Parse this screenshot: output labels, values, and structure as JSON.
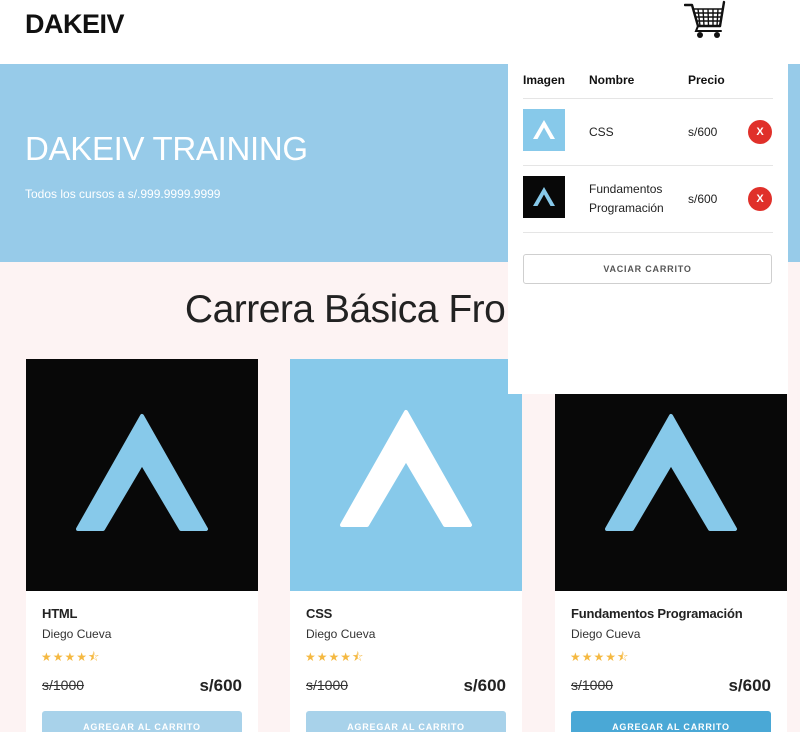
{
  "header": {
    "logo": "DAKEIV",
    "cart_icon": "shopping-cart-icon"
  },
  "hero": {
    "title": "DAKEIV TRAINING",
    "subtitle": "Todos los cursos a s/.999.9999.9999"
  },
  "courses": {
    "section_title": "Carrera Básica Front End",
    "cards": [
      {
        "name": "HTML",
        "author": "Diego Cueva",
        "rating": 4.5,
        "stars": "★★★★⯪",
        "old_price": "s/1000",
        "price": "s/600",
        "button": "AGREGAR AL CARRITO",
        "image_theme": "dark"
      },
      {
        "name": "CSS",
        "author": "Diego Cueva",
        "rating": 4.5,
        "stars": "★★★★⯪",
        "old_price": "s/1000",
        "price": "s/600",
        "button": "AGREGAR AL CARRITO",
        "image_theme": "light"
      },
      {
        "name": "Fundamentos Programación",
        "author": "Diego Cueva",
        "rating": 4.5,
        "stars": "★★★★⯪",
        "old_price": "s/1000",
        "price": "s/600",
        "button": "AGREGAR AL CARRITO",
        "image_theme": "dark"
      }
    ]
  },
  "cart": {
    "headers": {
      "image": "Imagen",
      "name": "Nombre",
      "price": "Precio"
    },
    "items": [
      {
        "name": "CSS",
        "price": "s/600",
        "remove": "X",
        "image_theme": "light"
      },
      {
        "name": "Fundamentos Programación",
        "price": "s/600",
        "remove": "X",
        "image_theme": "dark"
      }
    ],
    "empty_button": "VACIAR CARRITO"
  },
  "colors": {
    "hero_bg": "#97cbe9",
    "section_bg": "#fdf3f3",
    "logo_blue": "#87c9ea",
    "button_pale": "#a8d2ea",
    "button_solid": "#4aa8d6",
    "remove_red": "#e0302a",
    "star": "#f5b942"
  }
}
